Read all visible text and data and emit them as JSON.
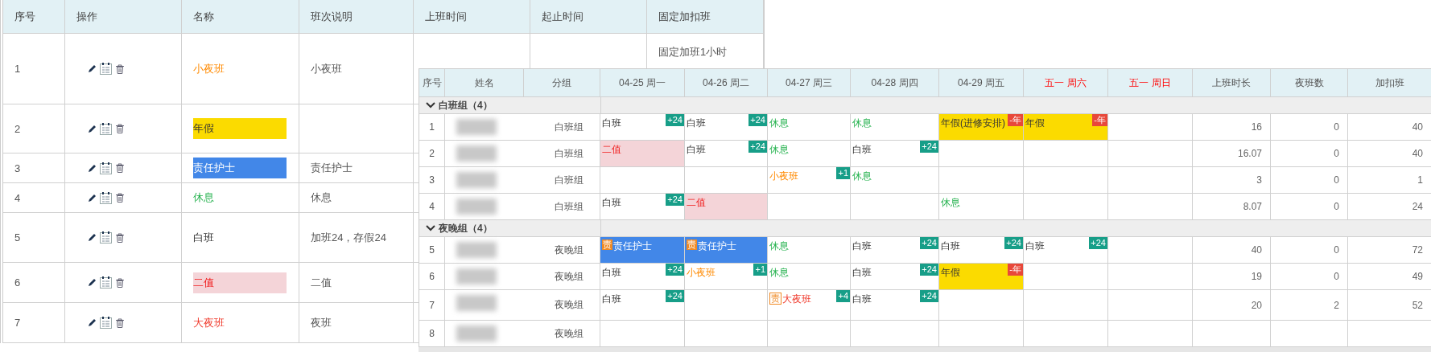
{
  "shift_table": {
    "columns": [
      "序号",
      "操作",
      "名称",
      "班次说明",
      "上班时间",
      "起止时间",
      "固定加扣班"
    ],
    "rows": [
      {
        "index": "1",
        "name": "小夜班",
        "kind": "small-night",
        "description": "小夜班",
        "fixed_overtime": "固定加班1小时"
      },
      {
        "index": "2",
        "name": "年假",
        "kind": "leave"
      },
      {
        "index": "3",
        "name": "责任护士",
        "kind": "nurse",
        "description": "责任护士"
      },
      {
        "index": "4",
        "name": "休息",
        "kind": "rest",
        "description": "休息"
      },
      {
        "index": "5",
        "name": "白班",
        "kind": "day",
        "description": "加班24，存假24"
      },
      {
        "index": "6",
        "name": "二值",
        "kind": "double",
        "description": "二值"
      },
      {
        "index": "7",
        "name": "大夜班",
        "kind": "big-night",
        "description": "夜班"
      }
    ]
  },
  "schedule": {
    "columns": [
      {
        "label": "序号",
        "holiday": false
      },
      {
        "label": "姓名",
        "holiday": false
      },
      {
        "label": "分组",
        "holiday": false
      },
      {
        "label": "04-25 周一",
        "holiday": false
      },
      {
        "label": "04-26 周二",
        "holiday": false
      },
      {
        "label": "04-27 周三",
        "holiday": false
      },
      {
        "label": "04-28 周四",
        "holiday": false
      },
      {
        "label": "04-29 周五",
        "holiday": false
      },
      {
        "label": "五一 周六",
        "holiday": true
      },
      {
        "label": "五一 周日",
        "holiday": true
      },
      {
        "label": "上班时长",
        "holiday": false
      },
      {
        "label": "夜班数",
        "holiday": false
      },
      {
        "label": "加扣班",
        "holiday": false
      }
    ],
    "groups": [
      {
        "name": "白班组（4）",
        "expanded": true,
        "rows": [
          {
            "index": "1",
            "group": "白班组",
            "cells": [
              {
                "text": "白班",
                "kind": "day",
                "badge": {
                  "text": "+24",
                  "kind": "plus"
                }
              },
              {
                "text": "白班",
                "kind": "day",
                "badge": {
                  "text": "+24",
                  "kind": "plus"
                }
              },
              {
                "text": "休息",
                "kind": "rest"
              },
              {
                "text": "休息",
                "kind": "rest"
              },
              {
                "text": "年假(进修安排)",
                "kind": "leave",
                "badge": {
                  "text": "-年",
                  "kind": "minus"
                }
              },
              {
                "text": "年假",
                "kind": "leave",
                "badge": {
                  "text": "-年",
                  "kind": "minus"
                }
              },
              null
            ],
            "hours": "16",
            "night_count": "0",
            "overtime": "40"
          },
          {
            "index": "2",
            "group": "白班组",
            "cells": [
              {
                "text": "二值",
                "kind": "double"
              },
              {
                "text": "白班",
                "kind": "day",
                "badge": {
                  "text": "+24",
                  "kind": "plus"
                }
              },
              {
                "text": "休息",
                "kind": "rest"
              },
              {
                "text": "白班",
                "kind": "day",
                "badge": {
                  "text": "+24",
                  "kind": "plus"
                }
              },
              null,
              null,
              null
            ],
            "hours": "16.07",
            "night_count": "0",
            "overtime": "40"
          },
          {
            "index": "3",
            "group": "白班组",
            "cells": [
              null,
              null,
              {
                "text": "小夜班",
                "kind": "small-night",
                "badge": {
                  "text": "+1",
                  "kind": "plus"
                }
              },
              {
                "text": "休息",
                "kind": "rest"
              },
              null,
              null,
              null
            ],
            "hours": "3",
            "night_count": "0",
            "overtime": "1"
          },
          {
            "index": "4",
            "group": "白班组",
            "cells": [
              {
                "text": "白班",
                "kind": "day",
                "badge": {
                  "text": "+24",
                  "kind": "plus"
                }
              },
              {
                "text": "二值",
                "kind": "double"
              },
              null,
              null,
              {
                "text": "休息",
                "kind": "rest"
              },
              null,
              null
            ],
            "hours": "8.07",
            "night_count": "0",
            "overtime": "24"
          }
        ]
      },
      {
        "name": "夜晚组（4）",
        "expanded": true,
        "rows": [
          {
            "index": "5",
            "group": "夜晚组",
            "cells": [
              {
                "text": "责任护士",
                "kind": "nurse",
                "tag": {
                  "text": "责",
                  "kind": "filled"
                }
              },
              {
                "text": "责任护士",
                "kind": "nurse",
                "tag": {
                  "text": "责",
                  "kind": "filled"
                }
              },
              {
                "text": "休息",
                "kind": "rest"
              },
              {
                "text": "白班",
                "kind": "day",
                "badge": {
                  "text": "+24",
                  "kind": "plus"
                }
              },
              {
                "text": "白班",
                "kind": "day",
                "badge": {
                  "text": "+24",
                  "kind": "plus"
                }
              },
              {
                "text": "白班",
                "kind": "day",
                "badge": {
                  "text": "+24",
                  "kind": "plus"
                }
              },
              null
            ],
            "hours": "40",
            "night_count": "0",
            "overtime": "72"
          },
          {
            "index": "6",
            "group": "夜晚组",
            "cells": [
              {
                "text": "白班",
                "kind": "day",
                "badge": {
                  "text": "+24",
                  "kind": "plus"
                }
              },
              {
                "text": "小夜班",
                "kind": "small-night",
                "badge": {
                  "text": "+1",
                  "kind": "plus"
                }
              },
              {
                "text": "休息",
                "kind": "rest"
              },
              {
                "text": "白班",
                "kind": "day",
                "badge": {
                  "text": "+24",
                  "kind": "plus"
                }
              },
              {
                "text": "年假",
                "kind": "leave",
                "badge": {
                  "text": "-年",
                  "kind": "minus"
                }
              },
              null,
              null
            ],
            "hours": "19",
            "night_count": "0",
            "overtime": "49"
          },
          {
            "index": "7",
            "group": "夜晚组",
            "cells": [
              {
                "text": "白班",
                "kind": "day",
                "badge": {
                  "text": "+24",
                  "kind": "plus"
                }
              },
              null,
              {
                "text": "大夜班",
                "kind": "big-night",
                "badge": {
                  "text": "+4",
                  "kind": "plus"
                },
                "tag": {
                  "text": "责",
                  "kind": "outline"
                }
              },
              {
                "text": "白班",
                "kind": "day",
                "badge": {
                  "text": "+24",
                  "kind": "plus"
                }
              },
              null,
              null,
              null
            ],
            "hours": "20",
            "night_count": "2",
            "overtime": "52"
          },
          {
            "index": "8",
            "group": "夜晚组",
            "cells": [
              null,
              null,
              null,
              null,
              null,
              null,
              null
            ]
          }
        ]
      }
    ]
  }
}
